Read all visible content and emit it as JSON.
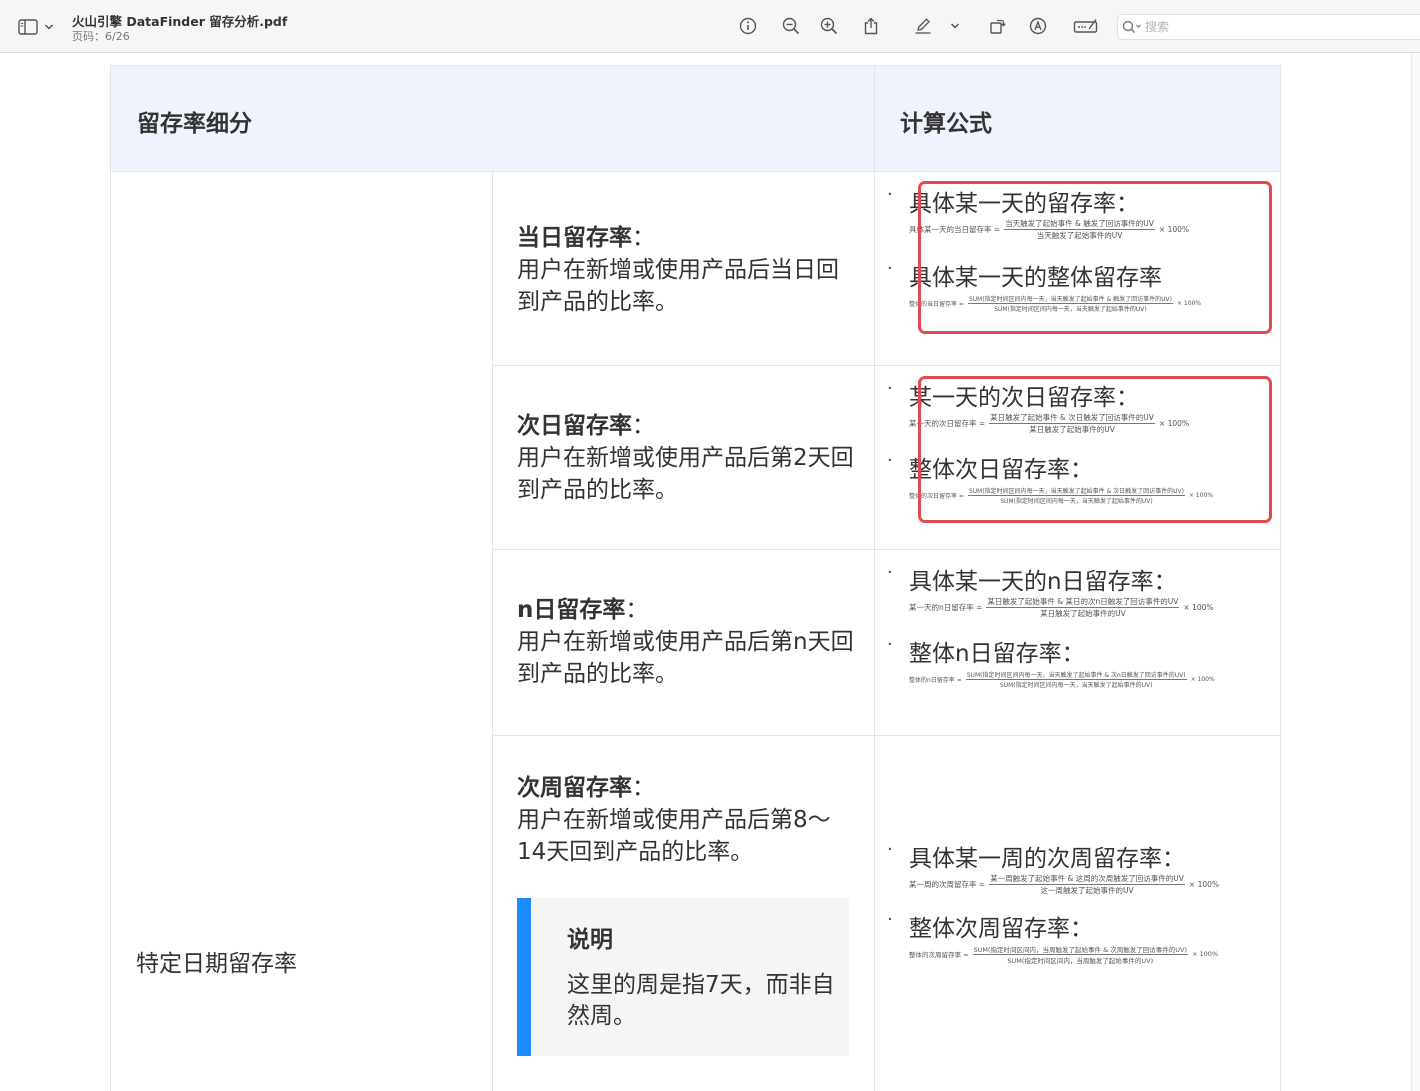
{
  "toolbar": {
    "doc_title": "火山引擎 DataFinder 留存分析.pdf",
    "page_info": "页码：6/26",
    "search_placeholder": "搜索",
    "icons": [
      "sidebar-icon",
      "chevron-down-icon",
      "info-icon",
      "zoom-out-icon",
      "zoom-in-icon",
      "share-icon",
      "markup-pen-icon",
      "chevron-down-icon",
      "rotate-icon",
      "annotate-icon",
      "form-fill-icon",
      "search-icon"
    ]
  },
  "table": {
    "header": {
      "col1": "留存率细分",
      "col2": "计算公式"
    },
    "left_label": "特定日期留存率",
    "rows": [
      {
        "name": "当日留存率",
        "desc": "用户在新增或使用产品后当日回到产品的比率。",
        "formulas": [
          {
            "title": "具体某一天的留存率：",
            "lhs": "具体某一天的当日留存率 =",
            "num": "当天触发了起始事件 & 触发了回访事件的UV",
            "den": "当天触发了起始事件的UV",
            "mult": "× 100%"
          },
          {
            "title": "具体某一天的整体留存率",
            "lhs": "整体的当日留存率 =",
            "num": "SUM(指定时间区间内每一天，当天触发了起始事件 & 触发了回访事件的UV)",
            "den": "SUM(指定时间区间内每一天，当天触发了起始事件的UV)",
            "mult": "× 100%"
          }
        ]
      },
      {
        "name": "次日留存率",
        "desc": "用户在新增或使用产品后第2天回到产品的比率。",
        "formulas": [
          {
            "title": "某一天的次日留存率：",
            "lhs": "某一天的次日留存率 =",
            "num": "某日触发了起始事件 & 次日触发了回访事件的UV",
            "den": "某日触发了起始事件的UV",
            "mult": "× 100%"
          },
          {
            "title": "整体次日留存率：",
            "lhs": "整体的次日留存率 =",
            "num": "SUM(指定时间区间内每一天，当天触发了起始事件 & 次日触发了回访事件的UV)",
            "den": "SUM(指定时间区间内每一天，当天触发了起始事件的UV)",
            "mult": "× 100%"
          }
        ]
      },
      {
        "name": "n日留存率",
        "desc": "用户在新增或使用产品后第n天回到产品的比率。",
        "formulas": [
          {
            "title": "具体某一天的n日留存率：",
            "lhs": "某一天的n日留存率 =",
            "num": "某日触发了起始事件 & 某日的次n日触发了回访事件的UV",
            "den": "某日触发了起始事件的UV",
            "mult": "× 100%"
          },
          {
            "title": "整体n日留存率：",
            "lhs": "整体的n日留存率 =",
            "num": "SUM(指定时间区间内每一天，当天触发了起始事件 & 次n日触发了回访事件的UV)",
            "den": "SUM(指定时间区间内每一天，当天触发了起始事件的UV)",
            "mult": "× 100%"
          }
        ]
      },
      {
        "name": "次周留存率",
        "desc": "用户在新增或使用产品后第8～14天回到产品的比率。",
        "note_title": "说明",
        "note_body": "这里的周是指7天，而非自然周。",
        "formulas": [
          {
            "title": "具体某一周的次周留存率：",
            "lhs": "某一周的次周留存率 =",
            "num": "某一周触发了起始事件 & 这周的次周触发了回访事件的UV",
            "den": "这一周触发了起始事件的UV",
            "mult": "× 100%"
          },
          {
            "title": "整体次周留存率：",
            "lhs": "整体的次周留存率 =",
            "num": "SUM(指定时间区间内，当周触发了起始事件 & 次周触发了回访事件的UV)",
            "den": "SUM(指定时间区间内，当周触发了起始事件的UV)",
            "mult": "× 100%"
          }
        ]
      }
    ],
    "colors": {
      "header_bg": "#eef3fc",
      "border": "#dfe6f2",
      "highlight": "#e14a4f",
      "note_accent": "#1a8cff"
    }
  }
}
